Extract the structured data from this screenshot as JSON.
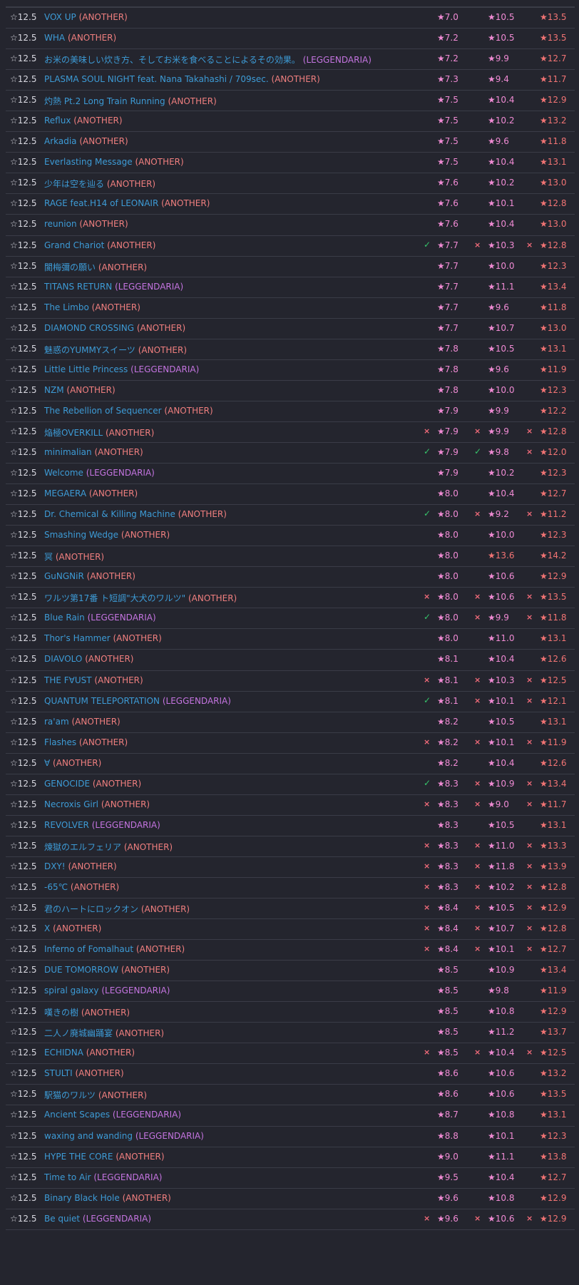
{
  "level_label": "☆12.5",
  "diff_colors": {
    "ANOTHER": "#f07f7f",
    "LEGGENDARIA": "#c474e0"
  },
  "rows": [
    {
      "title": "VOX UP",
      "diff": "ANOTHER",
      "m": [
        "",
        "",
        ""
      ],
      "v": [
        "★7.0",
        "★10.5",
        "★13.5"
      ],
      "hi2": false
    },
    {
      "title": "WHA",
      "diff": "ANOTHER",
      "m": [
        "",
        "",
        ""
      ],
      "v": [
        "★7.2",
        "★10.5",
        "★13.5"
      ],
      "hi2": false
    },
    {
      "title": "お米の美味しい炊き方、そしてお米を食べることによるその効果。",
      "diff": "LEGGENDARIA",
      "m": [
        "",
        "",
        ""
      ],
      "v": [
        "★7.2",
        "★9.9",
        "★12.7"
      ],
      "hi2": false
    },
    {
      "title": "PLASMA SOUL NIGHT feat. Nana Takahashi / 709sec.",
      "diff": "ANOTHER",
      "m": [
        "",
        "",
        ""
      ],
      "v": [
        "★7.3",
        "★9.4",
        "★11.7"
      ],
      "hi2": false
    },
    {
      "title": "灼熱 Pt.2 Long Train Running",
      "diff": "ANOTHER",
      "m": [
        "",
        "",
        ""
      ],
      "v": [
        "★7.5",
        "★10.4",
        "★12.9"
      ],
      "hi2": false
    },
    {
      "title": "Reflux",
      "diff": "ANOTHER",
      "m": [
        "",
        "",
        ""
      ],
      "v": [
        "★7.5",
        "★10.2",
        "★13.2"
      ],
      "hi2": false
    },
    {
      "title": "Arkadia",
      "diff": "ANOTHER",
      "m": [
        "",
        "",
        ""
      ],
      "v": [
        "★7.5",
        "★9.6",
        "★11.8"
      ],
      "hi2": false
    },
    {
      "title": "Everlasting Message",
      "diff": "ANOTHER",
      "m": [
        "",
        "",
        ""
      ],
      "v": [
        "★7.5",
        "★10.4",
        "★13.1"
      ],
      "hi2": false
    },
    {
      "title": "少年は空を辿る",
      "diff": "ANOTHER",
      "m": [
        "",
        "",
        ""
      ],
      "v": [
        "★7.6",
        "★10.2",
        "★13.0"
      ],
      "hi2": false
    },
    {
      "title": "RAGE feat.H14 of LEONAIR",
      "diff": "ANOTHER",
      "m": [
        "",
        "",
        ""
      ],
      "v": [
        "★7.6",
        "★10.1",
        "★12.8"
      ],
      "hi2": false
    },
    {
      "title": "reunion",
      "diff": "ANOTHER",
      "m": [
        "",
        "",
        ""
      ],
      "v": [
        "★7.6",
        "★10.4",
        "★13.0"
      ],
      "hi2": false
    },
    {
      "title": "Grand Chariot",
      "diff": "ANOTHER",
      "m": [
        "✓",
        "×",
        "×"
      ],
      "v": [
        "★7.7",
        "★10.3",
        "★12.8"
      ],
      "hi2": false
    },
    {
      "title": "閬梅彌の願い",
      "diff": "ANOTHER",
      "m": [
        "",
        "",
        ""
      ],
      "v": [
        "★7.7",
        "★10.0",
        "★12.3"
      ],
      "hi2": false
    },
    {
      "title": "TITANS RETURN",
      "diff": "LEGGENDARIA",
      "m": [
        "",
        "",
        ""
      ],
      "v": [
        "★7.7",
        "★11.1",
        "★13.4"
      ],
      "hi2": false
    },
    {
      "title": "The Limbo",
      "diff": "ANOTHER",
      "m": [
        "",
        "",
        ""
      ],
      "v": [
        "★7.7",
        "★9.6",
        "★11.8"
      ],
      "hi2": false
    },
    {
      "title": "DIAMOND CROSSING",
      "diff": "ANOTHER",
      "m": [
        "",
        "",
        ""
      ],
      "v": [
        "★7.7",
        "★10.7",
        "★13.0"
      ],
      "hi2": false
    },
    {
      "title": "魅惑のYUMMYスイーツ",
      "diff": "ANOTHER",
      "m": [
        "",
        "",
        ""
      ],
      "v": [
        "★7.8",
        "★10.5",
        "★13.1"
      ],
      "hi2": false
    },
    {
      "title": "Little Little Princess",
      "diff": "LEGGENDARIA",
      "m": [
        "",
        "",
        ""
      ],
      "v": [
        "★7.8",
        "★9.6",
        "★11.9"
      ],
      "hi2": false
    },
    {
      "title": "NZM",
      "diff": "ANOTHER",
      "m": [
        "",
        "",
        ""
      ],
      "v": [
        "★7.8",
        "★10.0",
        "★12.3"
      ],
      "hi2": false
    },
    {
      "title": "The Rebellion of Sequencer",
      "diff": "ANOTHER",
      "m": [
        "",
        "",
        ""
      ],
      "v": [
        "★7.9",
        "★9.9",
        "★12.2"
      ],
      "hi2": false
    },
    {
      "title": "焔極OVERKILL",
      "diff": "ANOTHER",
      "m": [
        "×",
        "×",
        "×"
      ],
      "v": [
        "★7.9",
        "★9.9",
        "★12.8"
      ],
      "hi2": false
    },
    {
      "title": "minimalian",
      "diff": "ANOTHER",
      "m": [
        "✓",
        "✓",
        "×"
      ],
      "v": [
        "★7.9",
        "★9.8",
        "★12.0"
      ],
      "hi2": false
    },
    {
      "title": "Welcome",
      "diff": "LEGGENDARIA",
      "m": [
        "",
        "",
        ""
      ],
      "v": [
        "★7.9",
        "★10.2",
        "★12.3"
      ],
      "hi2": false
    },
    {
      "title": "MEGAERA",
      "diff": "ANOTHER",
      "m": [
        "",
        "",
        ""
      ],
      "v": [
        "★8.0",
        "★10.4",
        "★12.7"
      ],
      "hi2": false
    },
    {
      "title": "Dr. Chemical & Killing Machine",
      "diff": "ANOTHER",
      "m": [
        "✓",
        "×",
        "×"
      ],
      "v": [
        "★8.0",
        "★9.2",
        "★11.2"
      ],
      "hi2": false
    },
    {
      "title": "Smashing Wedge",
      "diff": "ANOTHER",
      "m": [
        "",
        "",
        ""
      ],
      "v": [
        "★8.0",
        "★10.0",
        "★12.3"
      ],
      "hi2": false
    },
    {
      "title": "冥",
      "diff": "ANOTHER",
      "m": [
        "",
        "",
        ""
      ],
      "v": [
        "★8.0",
        "★13.6",
        "★14.2"
      ],
      "hi2": true
    },
    {
      "title": "GuNGNiR",
      "diff": "ANOTHER",
      "m": [
        "",
        "",
        ""
      ],
      "v": [
        "★8.0",
        "★10.6",
        "★12.9"
      ],
      "hi2": false
    },
    {
      "title": "ワルツ第17番 ト短調\"大犬のワルツ\"",
      "diff": "ANOTHER",
      "m": [
        "×",
        "×",
        "×"
      ],
      "v": [
        "★8.0",
        "★10.6",
        "★13.5"
      ],
      "hi2": false
    },
    {
      "title": "Blue Rain",
      "diff": "LEGGENDARIA",
      "m": [
        "✓",
        "×",
        "×"
      ],
      "v": [
        "★8.0",
        "★9.9",
        "★11.8"
      ],
      "hi2": false
    },
    {
      "title": "Thor's Hammer",
      "diff": "ANOTHER",
      "m": [
        "",
        "",
        ""
      ],
      "v": [
        "★8.0",
        "★11.0",
        "★13.1"
      ],
      "hi2": false
    },
    {
      "title": "DIAVOLO",
      "diff": "ANOTHER",
      "m": [
        "",
        "",
        ""
      ],
      "v": [
        "★8.1",
        "★10.4",
        "★12.6"
      ],
      "hi2": false
    },
    {
      "title": "THE F∀UST",
      "diff": "ANOTHER",
      "m": [
        "×",
        "×",
        "×"
      ],
      "v": [
        "★8.1",
        "★10.3",
        "★12.5"
      ],
      "hi2": false
    },
    {
      "title": "QUANTUM TELEPORTATION",
      "diff": "LEGGENDARIA",
      "m": [
        "✓",
        "×",
        "×"
      ],
      "v": [
        "★8.1",
        "★10.1",
        "★12.1"
      ],
      "hi2": false
    },
    {
      "title": "ra'am",
      "diff": "ANOTHER",
      "m": [
        "",
        "",
        ""
      ],
      "v": [
        "★8.2",
        "★10.5",
        "★13.1"
      ],
      "hi2": false
    },
    {
      "title": "Flashes",
      "diff": "ANOTHER",
      "m": [
        "×",
        "×",
        "×"
      ],
      "v": [
        "★8.2",
        "★10.1",
        "★11.9"
      ],
      "hi2": false
    },
    {
      "title": "∀",
      "diff": "ANOTHER",
      "m": [
        "",
        "",
        ""
      ],
      "v": [
        "★8.2",
        "★10.4",
        "★12.6"
      ],
      "hi2": false
    },
    {
      "title": "GENOCIDE",
      "diff": "ANOTHER",
      "m": [
        "✓",
        "×",
        "×"
      ],
      "v": [
        "★8.3",
        "★10.9",
        "★13.4"
      ],
      "hi2": false
    },
    {
      "title": "Necroxis Girl",
      "diff": "ANOTHER",
      "m": [
        "×",
        "×",
        "×"
      ],
      "v": [
        "★8.3",
        "★9.0",
        "★11.7"
      ],
      "hi2": false
    },
    {
      "title": "REVOLVER",
      "diff": "LEGGENDARIA",
      "m": [
        "",
        "",
        ""
      ],
      "v": [
        "★8.3",
        "★10.5",
        "★13.1"
      ],
      "hi2": false
    },
    {
      "title": "煉獄のエルフェリア",
      "diff": "ANOTHER",
      "m": [
        "×",
        "×",
        "×"
      ],
      "v": [
        "★8.3",
        "★11.0",
        "★13.3"
      ],
      "hi2": false
    },
    {
      "title": "DXY!",
      "diff": "ANOTHER",
      "m": [
        "×",
        "×",
        "×"
      ],
      "v": [
        "★8.3",
        "★11.8",
        "★13.9"
      ],
      "hi2": false
    },
    {
      "title": "-65℃",
      "diff": "ANOTHER",
      "m": [
        "×",
        "×",
        "×"
      ],
      "v": [
        "★8.3",
        "★10.2",
        "★12.8"
      ],
      "hi2": false
    },
    {
      "title": "君のハートにロックオン",
      "diff": "ANOTHER",
      "m": [
        "×",
        "×",
        "×"
      ],
      "v": [
        "★8.4",
        "★10.5",
        "★12.9"
      ],
      "hi2": false
    },
    {
      "title": "X",
      "diff": "ANOTHER",
      "m": [
        "×",
        "×",
        "×"
      ],
      "v": [
        "★8.4",
        "★10.7",
        "★12.8"
      ],
      "hi2": false
    },
    {
      "title": "Inferno of Fomalhaut",
      "diff": "ANOTHER",
      "m": [
        "×",
        "×",
        "×"
      ],
      "v": [
        "★8.4",
        "★10.1",
        "★12.7"
      ],
      "hi2": false
    },
    {
      "title": "DUE TOMORROW",
      "diff": "ANOTHER",
      "m": [
        "",
        "",
        ""
      ],
      "v": [
        "★8.5",
        "★10.9",
        "★13.4"
      ],
      "hi2": false
    },
    {
      "title": "spiral galaxy",
      "diff": "LEGGENDARIA",
      "m": [
        "",
        "",
        ""
      ],
      "v": [
        "★8.5",
        "★9.8",
        "★11.9"
      ],
      "hi2": false
    },
    {
      "title": "嘆きの樹",
      "diff": "ANOTHER",
      "m": [
        "",
        "",
        ""
      ],
      "v": [
        "★8.5",
        "★10.8",
        "★12.9"
      ],
      "hi2": false
    },
    {
      "title": "二人ノ廃城幽踊宴",
      "diff": "ANOTHER",
      "m": [
        "",
        "",
        ""
      ],
      "v": [
        "★8.5",
        "★11.2",
        "★13.7"
      ],
      "hi2": false
    },
    {
      "title": "ECHIDNA",
      "diff": "ANOTHER",
      "m": [
        "×",
        "×",
        "×"
      ],
      "v": [
        "★8.5",
        "★10.4",
        "★12.5"
      ],
      "hi2": false
    },
    {
      "title": "STULTI",
      "diff": "ANOTHER",
      "m": [
        "",
        "",
        ""
      ],
      "v": [
        "★8.6",
        "★10.6",
        "★13.2"
      ],
      "hi2": false
    },
    {
      "title": "駅猫のワルツ",
      "diff": "ANOTHER",
      "m": [
        "",
        "",
        ""
      ],
      "v": [
        "★8.6",
        "★10.6",
        "★13.5"
      ],
      "hi2": false
    },
    {
      "title": "Ancient Scapes",
      "diff": "LEGGENDARIA",
      "m": [
        "",
        "",
        ""
      ],
      "v": [
        "★8.7",
        "★10.8",
        "★13.1"
      ],
      "hi2": false
    },
    {
      "title": "waxing and wanding",
      "diff": "LEGGENDARIA",
      "m": [
        "",
        "",
        ""
      ],
      "v": [
        "★8.8",
        "★10.1",
        "★12.3"
      ],
      "hi2": false
    },
    {
      "title": "HYPE THE CORE",
      "diff": "ANOTHER",
      "m": [
        "",
        "",
        ""
      ],
      "v": [
        "★9.0",
        "★11.1",
        "★13.8"
      ],
      "hi2": false
    },
    {
      "title": "Time to Air",
      "diff": "LEGGENDARIA",
      "m": [
        "",
        "",
        ""
      ],
      "v": [
        "★9.5",
        "★10.4",
        "★12.7"
      ],
      "hi2": false
    },
    {
      "title": "Binary Black Hole",
      "diff": "ANOTHER",
      "m": [
        "",
        "",
        ""
      ],
      "v": [
        "★9.6",
        "★10.8",
        "★12.9"
      ],
      "hi2": false
    },
    {
      "title": "Be quiet",
      "diff": "LEGGENDARIA",
      "m": [
        "×",
        "×",
        "×"
      ],
      "v": [
        "★9.6",
        "★10.6",
        "★12.9"
      ],
      "hi2": false
    }
  ]
}
